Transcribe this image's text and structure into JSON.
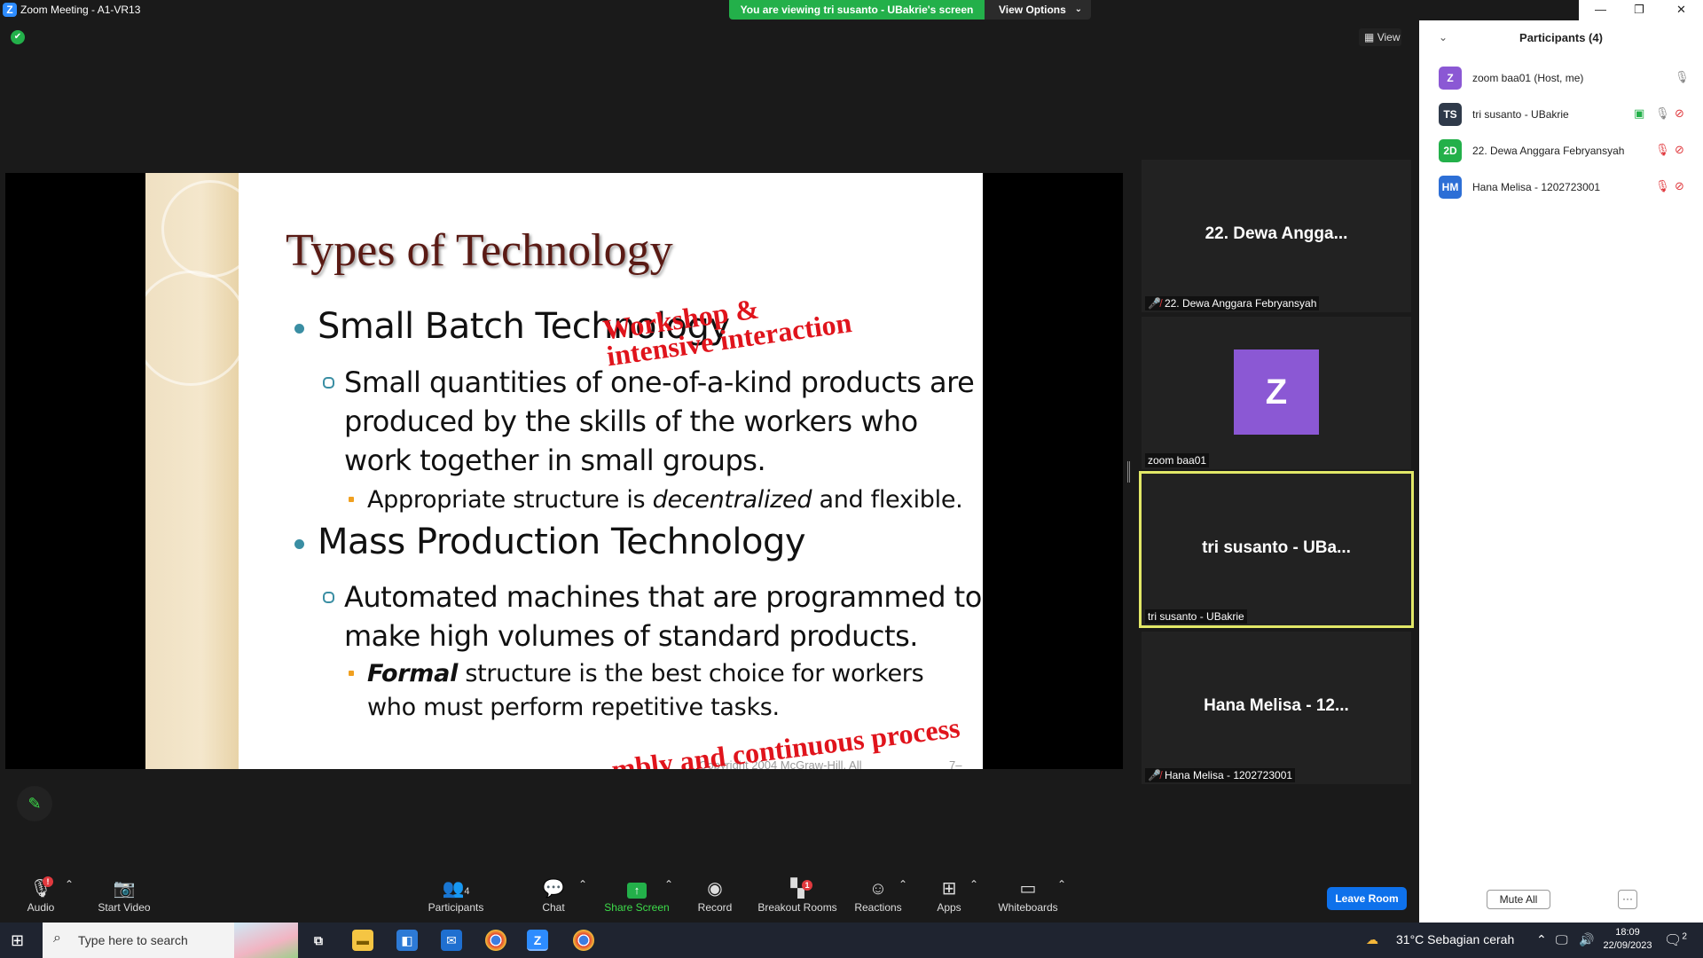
{
  "window": {
    "title": "Zoom Meeting - A1-VR13"
  },
  "banner": {
    "text": "You are viewing tri susanto - UBakrie's screen",
    "view_options": "View Options"
  },
  "view_button": "View",
  "slide": {
    "title": "Types of Technology",
    "bullet1": "Small Batch Technology",
    "bullet1_sub": [
      "Small quantities of one-of-a-kind products are",
      "produced by the skills of the workers who",
      "work together in small groups."
    ],
    "bullet1_subsub_pre": "Appropriate structure is ",
    "bullet1_subsub_em": "decentralized",
    "bullet1_subsub_post": " and flexible.",
    "bullet2": "Mass Production Technology",
    "bullet2_sub": [
      "Automated machines that are programmed to",
      "make high volumes of standard products."
    ],
    "bullet2_subsub_em": "Formal",
    "bullet2_subsub_post": " structure is the best choice for workers",
    "bullet2_subsub_line2": "who must perform repetitive tasks.",
    "annotation1_line1": "Workshop &",
    "annotation1_line2": "intensive interaction",
    "annotation2": "mbly and continuous process",
    "footer": "Copyright 2004 McGraw-Hill. All",
    "page": "7–"
  },
  "tiles": [
    {
      "big": "22. Dewa Angga...",
      "caption": "22. Dewa Anggara Febryansyah",
      "muted": true
    },
    {
      "avatar": "Z",
      "caption": "zoom baa01"
    },
    {
      "big": "tri susanto - UBa...",
      "caption": "tri susanto - UBakrie"
    },
    {
      "big": "Hana Melisa - 12...",
      "caption": "Hana Melisa - 1202723001",
      "muted": true
    }
  ],
  "toolbar": {
    "audio": "Audio",
    "start_video": "Start Video",
    "participants": "Participants",
    "participants_count": "4",
    "chat": "Chat",
    "share_screen": "Share Screen",
    "record": "Record",
    "breakout_rooms": "Breakout Rooms",
    "breakout_badge": "1",
    "audio_badge": "!",
    "reactions": "Reactions",
    "apps": "Apps",
    "whiteboards": "Whiteboards",
    "leave": "Leave Room"
  },
  "panel": {
    "title": "Participants (4)",
    "participants": [
      {
        "initials": "Z",
        "name": "zoom baa01 (Host, me)",
        "color": "#8b58d4"
      },
      {
        "initials": "TS",
        "name": "tri susanto - UBakrie",
        "color": "#2f3a4a"
      },
      {
        "initials": "2D",
        "name": "22. Dewa Anggara Febryansyah",
        "color": "#23b04a"
      },
      {
        "initials": "HM",
        "name": "Hana Melisa - 1202723001",
        "color": "#2d6fd6"
      }
    ],
    "mute_all": "Mute All",
    "more": "···"
  },
  "taskbar": {
    "search_placeholder": "Type here to search",
    "weather": "31°C  Sebagian cerah",
    "time": "18:09",
    "date": "22/09/2023",
    "notifications": "2"
  }
}
